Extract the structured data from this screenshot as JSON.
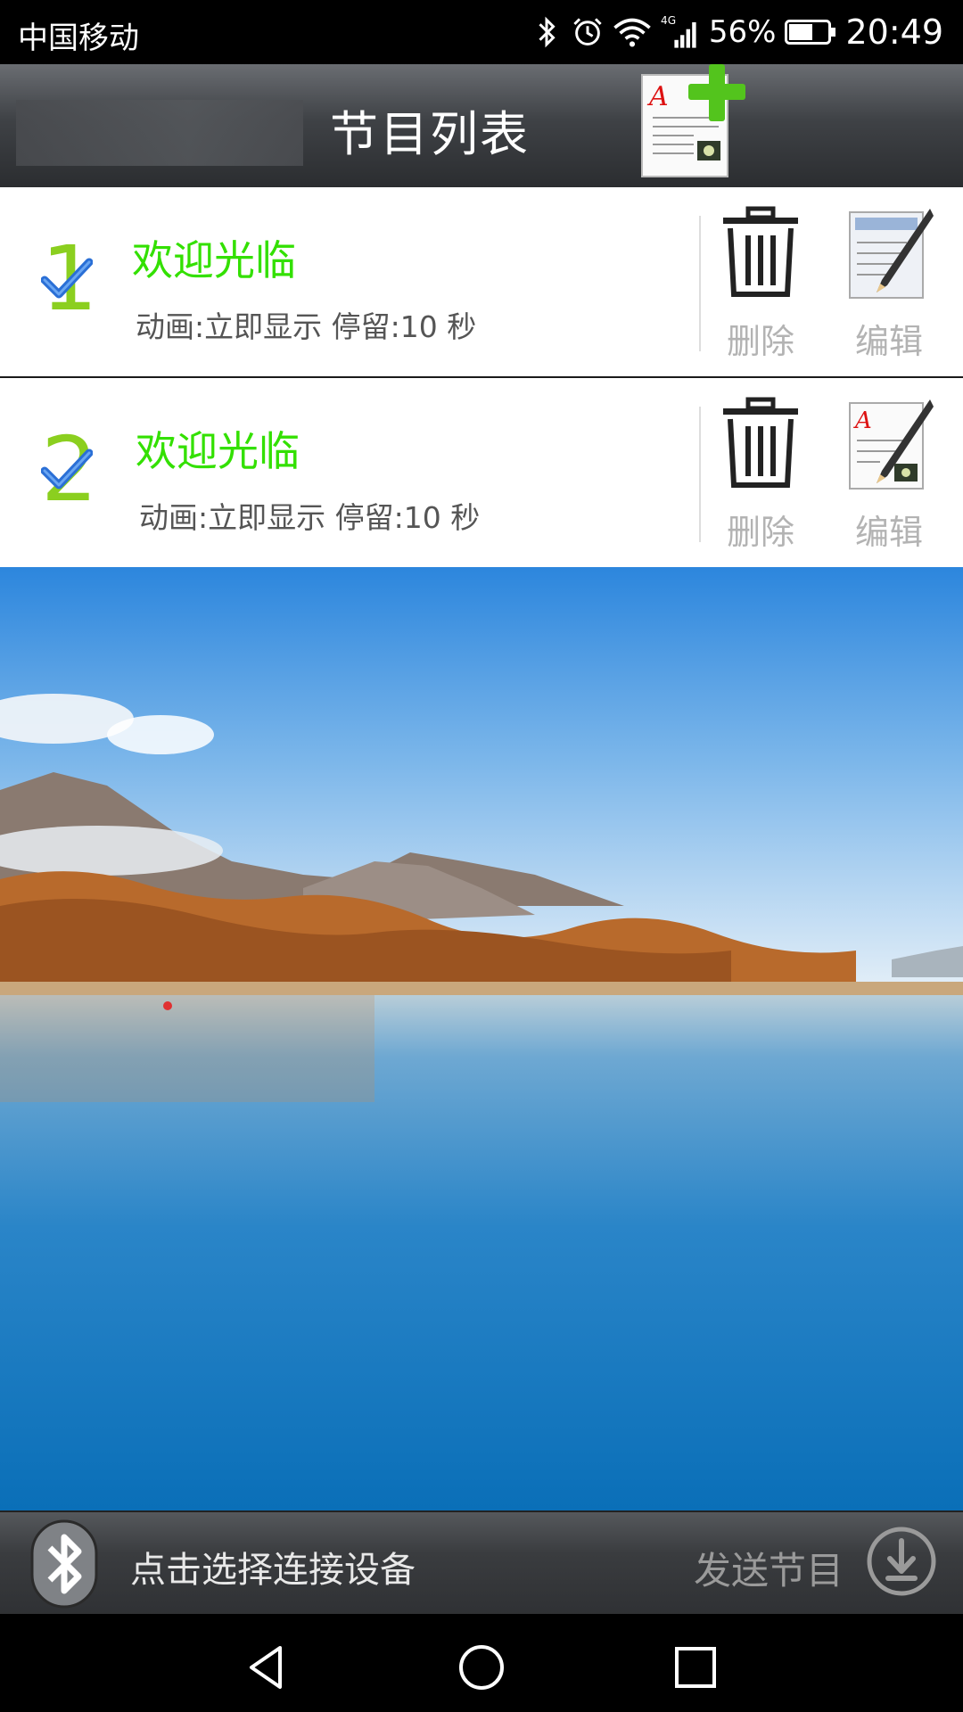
{
  "status_bar": {
    "carrier": "中国移动",
    "network": "4G",
    "battery_percent": "56%",
    "time": "20:49",
    "icons": [
      "bluetooth-icon",
      "alarm-icon",
      "wifi-icon",
      "signal-icon",
      "battery-icon"
    ]
  },
  "app_bar": {
    "title": "节目列表",
    "add_button_icon": "add-program-icon"
  },
  "programs": [
    {
      "index": "1",
      "name": "欢迎光临",
      "detail": "动画:立即显示 停留:10 秒",
      "checked": true,
      "delete_label": "删除",
      "edit_label": "编辑"
    },
    {
      "index": "2",
      "name": "欢迎光临",
      "detail": "动画:立即显示 停留:10 秒",
      "checked": true,
      "delete_label": "删除",
      "edit_label": "编辑"
    }
  ],
  "bottom_bar": {
    "connect_label": "点击选择连接设备",
    "send_label": "发送节目"
  },
  "colors": {
    "program_name": "#33e000",
    "index_number": "#8bcf1f",
    "check": "#2a6fd6",
    "action_label": "#b3b3b3"
  }
}
